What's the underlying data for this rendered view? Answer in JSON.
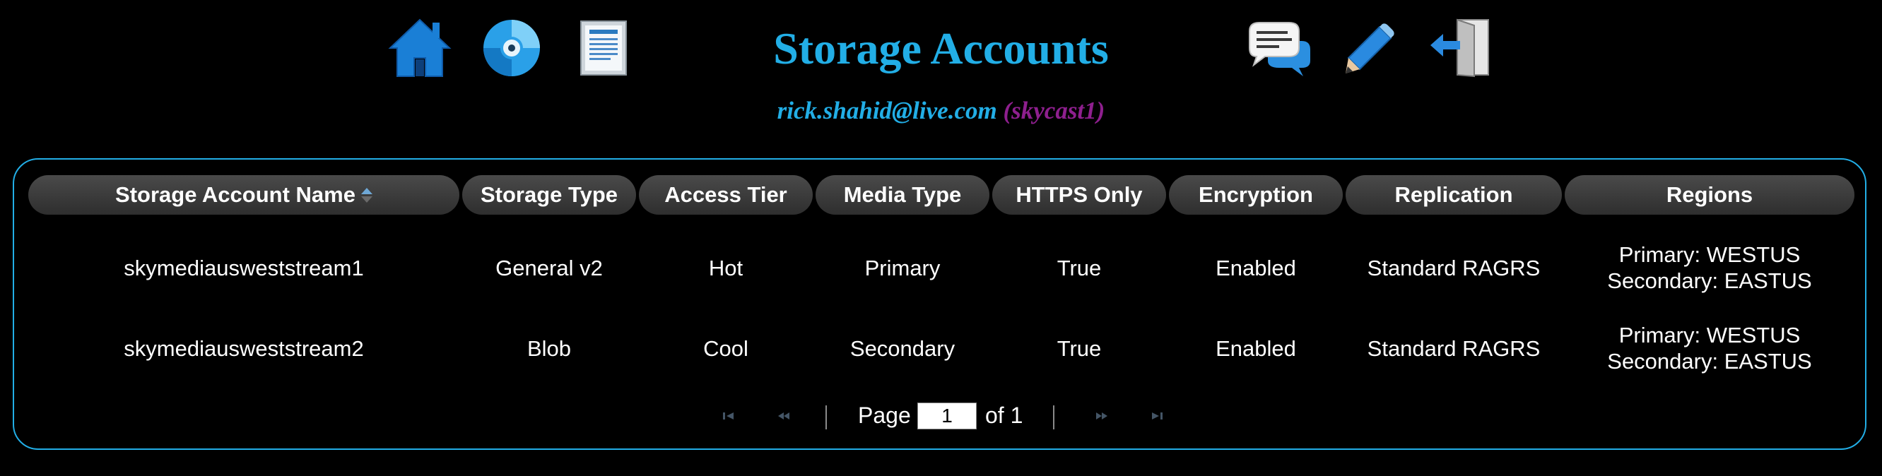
{
  "header": {
    "title": "Storage Accounts",
    "user_email": "rick.shahid@live.com",
    "account_name": "(skycast1)",
    "nav_icons": [
      "home-icon",
      "disc-icon",
      "document-icon",
      "chat-icon",
      "pencil-icon",
      "logout-icon"
    ]
  },
  "table": {
    "columns": [
      "Storage Account Name",
      "Storage Type",
      "Access Tier",
      "Media Type",
      "HTTPS Only",
      "Encryption",
      "Replication",
      "Regions"
    ],
    "rows": [
      {
        "name": "skymediausweststream1",
        "storage_type": "General v2",
        "access_tier": "Hot",
        "media_type": "Primary",
        "https_only": "True",
        "encryption": "Enabled",
        "replication": "Standard RAGRS",
        "region_primary": "Primary: WESTUS",
        "region_secondary": "Secondary: EASTUS"
      },
      {
        "name": "skymediausweststream2",
        "storage_type": "Blob",
        "access_tier": "Cool",
        "media_type": "Secondary",
        "https_only": "True",
        "encryption": "Enabled",
        "replication": "Standard RAGRS",
        "region_primary": "Primary: WESTUS",
        "region_secondary": "Secondary: EASTUS"
      }
    ]
  },
  "pager": {
    "page_label": "Page",
    "current_page": "1",
    "of_label": "of 1"
  },
  "colors": {
    "accent": "#22aee6",
    "account": "#8e1f8e",
    "background": "#000000"
  }
}
